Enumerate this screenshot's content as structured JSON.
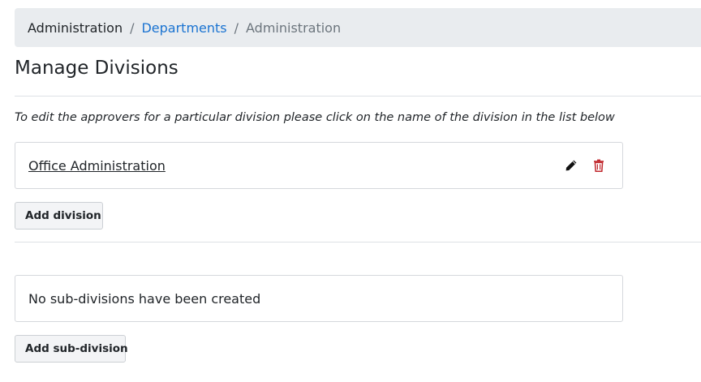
{
  "breadcrumb": {
    "home": "Administration",
    "separator": "/",
    "link": "Departments",
    "current": "Administration"
  },
  "page": {
    "title": "Manage Divisions",
    "instructions": "To edit the approvers for a particular division please click on the name of the division in the list below"
  },
  "divisions": {
    "items": [
      {
        "name": "Office Administration",
        "edit_icon": "pencil-icon",
        "delete_icon": "trash-icon"
      }
    ],
    "add_button": "Add division"
  },
  "subdivisions": {
    "empty_message": "No sub-divisions have been created",
    "add_button": "Add sub-division"
  },
  "colors": {
    "breadcrumb_bg": "#e9ecef",
    "link": "#1a73d1",
    "delete": "#c0282d",
    "text": "#212529",
    "muted": "#6c757d",
    "border": "#dee2e6"
  }
}
